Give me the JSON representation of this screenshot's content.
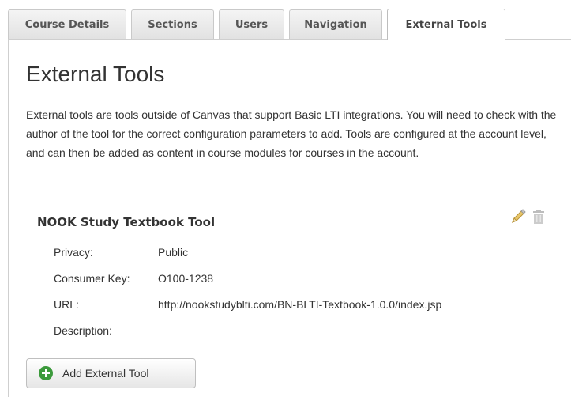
{
  "tabs": [
    {
      "label": "Course Details"
    },
    {
      "label": "Sections"
    },
    {
      "label": "Users"
    },
    {
      "label": "Navigation"
    },
    {
      "label": "External Tools",
      "active": true
    }
  ],
  "page": {
    "title": "External Tools",
    "intro": "External tools are tools outside of Canvas that support Basic LTI integrations. You will need to check with the author of the tool for the correct configuration parameters to add. Tools are configured at the account level, and can then be added as content in course modules for courses in the account."
  },
  "tool": {
    "name": "NOOK Study Textbook Tool",
    "edit_icon": "pencil-icon",
    "delete_icon": "trash-icon",
    "details": [
      {
        "label": "Privacy:",
        "value": "Public"
      },
      {
        "label": "Consumer Key:",
        "value": "O100-1238"
      },
      {
        "label": "URL:",
        "value": "http://nookstudyblti.com/BN-BLTI-Textbook-1.0.0/index.jsp"
      },
      {
        "label": "Description:",
        "value": ""
      }
    ]
  },
  "add_button": {
    "label": "Add External Tool",
    "icon": "plus-circle-icon"
  },
  "colors": {
    "add_icon": "#3c9a3c",
    "text": "#333333",
    "tab_border": "#c9c9c9"
  }
}
